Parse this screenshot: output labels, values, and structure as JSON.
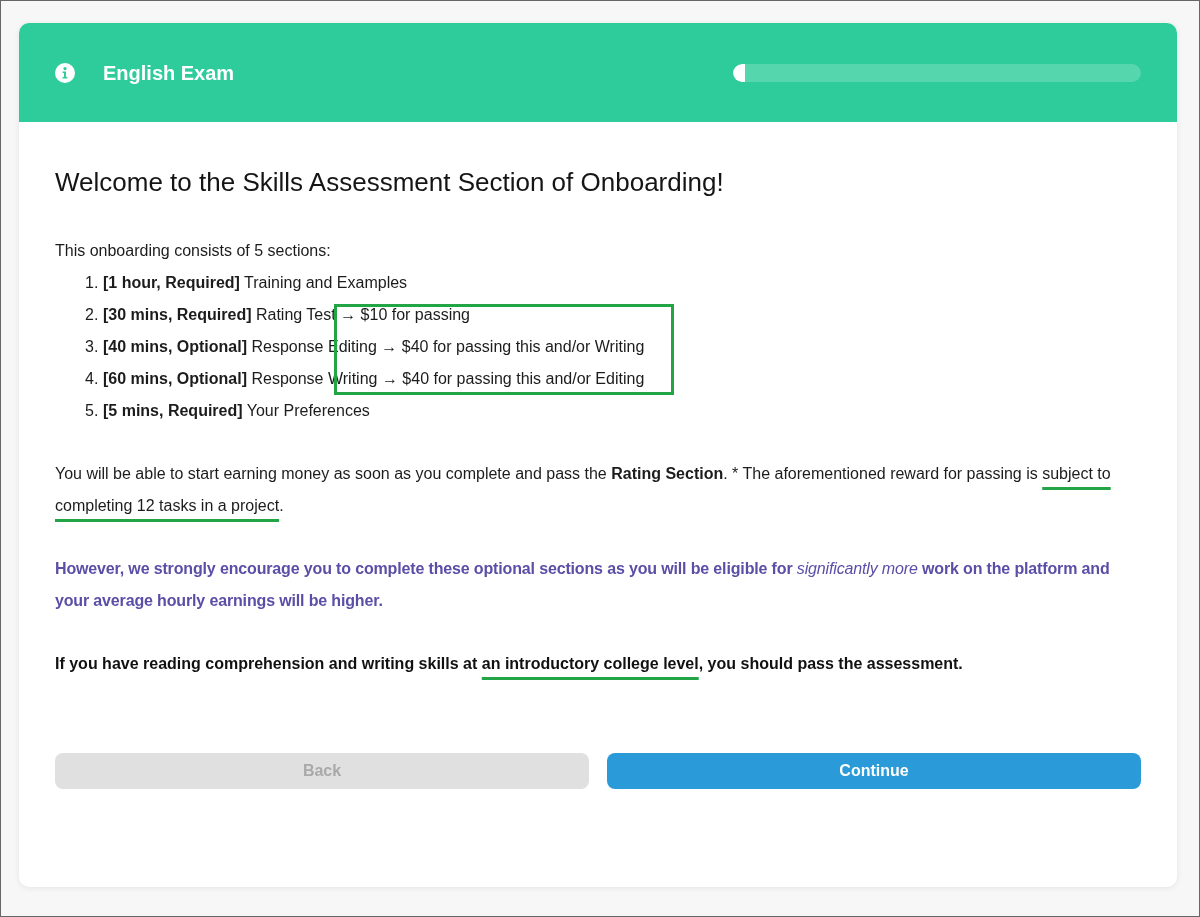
{
  "header": {
    "title": "English Exam",
    "progress": {
      "level": 0.03
    }
  },
  "heading": "Welcome to the Skills Assessment Section of Onboarding!",
  "intro": "This onboarding consists of 5 sections:",
  "sections": [
    {
      "number": "1.",
      "label": "[1 hour, Required]",
      "name": "Training and Examples",
      "highlighted": false
    },
    {
      "number": "2.",
      "label": "[30 mins, Required]",
      "name": "Rating Test",
      "reward": "→ $10 for passing",
      "highlighted": true
    },
    {
      "number": "3.",
      "label": "[40 mins, Optional]",
      "name": "Response Editing",
      "reward": "→ $40 for passing this and/or Writing",
      "highlighted": true
    },
    {
      "number": "4.",
      "label": "[60 mins, Optional]",
      "name": "Response Writing",
      "reward": "→ $40 for passing this and/or Editing",
      "highlighted": true
    },
    {
      "number": "5.",
      "label": "[5 mins, Required]",
      "name": "Your Preferences",
      "highlighted": false
    }
  ],
  "paragraphs": [
    {
      "kind": "plain",
      "segments": [
        {
          "kind": "plain",
          "text": "You will be able to start earning money as soon as you complete and pass the "
        },
        {
          "kind": "bold",
          "text": "Rating Section"
        },
        {
          "kind": "plain",
          "text": ". * The aforementioned reward for passing is "
        },
        {
          "kind": "underlined",
          "text": "subject to completing 12 tasks in a project"
        },
        {
          "kind": "plain",
          "text": "."
        }
      ]
    },
    {
      "kind": "notice",
      "segments": [
        {
          "kind": "plain",
          "text": "However, we strongly encourage you to complete these optional sections as you will be eligible for "
        },
        {
          "kind": "italic",
          "text": "significantly more"
        },
        {
          "kind": "plain",
          "text": " work on the platform and your average hourly earnings will be higher."
        }
      ]
    },
    {
      "kind": "strong",
      "segments": [
        {
          "kind": "plain",
          "text": "If you have reading comprehension and writing skills at "
        },
        {
          "kind": "underlined",
          "text": "an introductory college level"
        },
        {
          "kind": "plain",
          "text": ", you should pass the assessment."
        }
      ]
    }
  ],
  "buttons": [
    {
      "label": "Back",
      "disabled": true
    },
    {
      "label": "Continue",
      "disabled": false
    }
  ]
}
